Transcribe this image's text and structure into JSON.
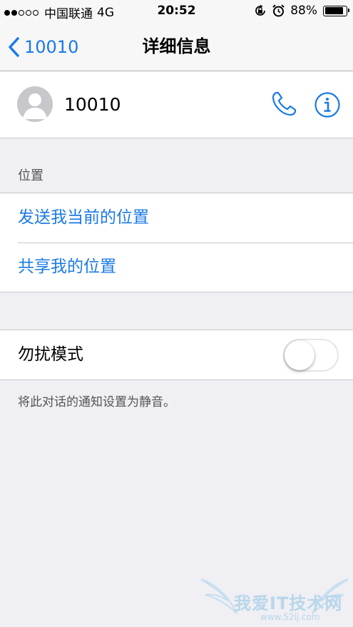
{
  "status_bar": {
    "carrier": "中国联通",
    "network": "4G",
    "time": "20:52",
    "battery": "88%",
    "battery_level": 0.88
  },
  "nav": {
    "back_label": "10010",
    "title": "详细信息"
  },
  "contact": {
    "name": "10010",
    "call_icon": "phone-icon",
    "info_icon": "info-icon"
  },
  "location": {
    "header": "位置",
    "send_current": "发送我当前的位置",
    "share": "共享我的位置"
  },
  "dnd": {
    "label": "勿扰模式",
    "enabled": false,
    "note": "将此对话的通知设置为静音。"
  },
  "watermark": {
    "text": "我爱IT技术网",
    "url": "www.52ij.com"
  },
  "colors": {
    "accent": "#1a7ae6",
    "background": "#efeff4"
  }
}
